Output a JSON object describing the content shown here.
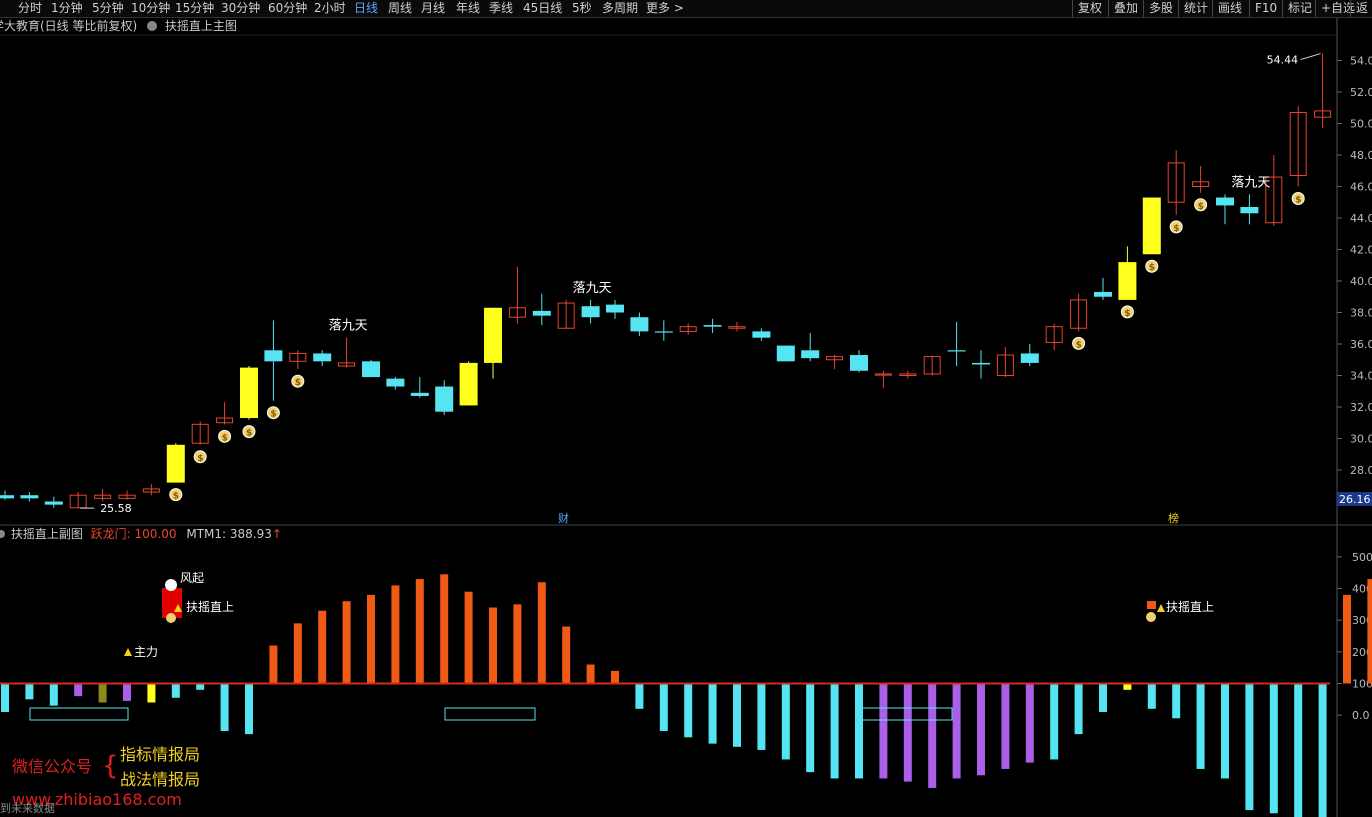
{
  "toolbar": {
    "periods": [
      "分时",
      "1分钟",
      "5分钟",
      "10分钟",
      "15分钟",
      "30分钟",
      "60分钟",
      "2小时",
      "日线",
      "周线",
      "月线",
      "年线",
      "季线",
      "45日线",
      "5秒",
      "多周期",
      "更多 >"
    ],
    "active_period": "日线",
    "right_buttons": [
      "复权",
      "叠加",
      "多股",
      "统计",
      "画线",
      "F10",
      "标记",
      "+自选",
      "返"
    ]
  },
  "main_panel": {
    "title": "学大教育(日线 等比前复权)",
    "indicator": "扶摇直上主图",
    "price_axis_ticks": [
      "54.0",
      "52.0",
      "50.0",
      "48.0",
      "46.0",
      "44.0",
      "42.0",
      "40.0",
      "38.0",
      "36.0",
      "34.0",
      "32.0",
      "30.0",
      "28.0"
    ],
    "current_price": "26.16",
    "high_label": "54.44",
    "low_label": "25.58",
    "pattern_labels": [
      "落九天",
      "落九天",
      "落九天"
    ],
    "event_marks": [
      "财",
      "榜"
    ]
  },
  "sub_panel": {
    "title": "扶摇直上副图",
    "line1_label": "跃龙门: 100.00",
    "line2_label": "MTM1: 388.93",
    "trend_arrow": "↑",
    "axis_ticks": [
      "500",
      "400",
      "300",
      "200",
      "100",
      "0.0"
    ],
    "signals": {
      "wind": "风起",
      "rise": "扶摇直上",
      "rise2": "扶摇直上",
      "main": "主力"
    }
  },
  "watermark": {
    "label": "微信公众号",
    "brace": "{",
    "line1": "指标情报局",
    "line2": "战法情报局",
    "url": "www.zhibiao168.com",
    "bottom_text": "到未来数据"
  },
  "colors": {
    "up": "#e8452e",
    "down": "#54e4f2",
    "highlight": "#ffff1e",
    "bg": "#000000",
    "grid": "#8b1a1a",
    "green_bar": "#22d822",
    "purple_bar": "#a95fe8",
    "orange_bar": "#f05a14",
    "red_bar": "#e00000",
    "olive_bar": "#8a8a18",
    "zero_line": "#d82a1a"
  },
  "chart_data": [
    {
      "type": "candlestick",
      "title": "扶摇直上主图",
      "ylim": [
        25,
        56
      ],
      "candles": [
        {
          "o": 26.4,
          "h": 26.7,
          "l": 26.1,
          "c": 26.2,
          "k": "down"
        },
        {
          "o": 26.4,
          "h": 26.6,
          "l": 26.0,
          "c": 26.2,
          "k": "down"
        },
        {
          "o": 26.0,
          "h": 26.3,
          "l": 25.6,
          "c": 25.8,
          "k": "down"
        },
        {
          "o": 25.6,
          "h": 26.6,
          "l": 25.58,
          "c": 26.4,
          "k": "up"
        },
        {
          "o": 26.2,
          "h": 26.8,
          "l": 26.0,
          "c": 26.4,
          "k": "up"
        },
        {
          "o": 26.2,
          "h": 26.7,
          "l": 26.1,
          "c": 26.4,
          "k": "up"
        },
        {
          "o": 26.6,
          "h": 27.1,
          "l": 26.4,
          "c": 26.8,
          "k": "up"
        },
        {
          "o": 27.2,
          "h": 29.7,
          "l": 27.2,
          "c": 29.6,
          "k": "hl"
        },
        {
          "o": 29.7,
          "h": 31.1,
          "l": 29.6,
          "c": 30.9,
          "k": "up"
        },
        {
          "o": 31.0,
          "h": 32.3,
          "l": 30.9,
          "c": 31.3,
          "k": "up"
        },
        {
          "o": 31.3,
          "h": 34.6,
          "l": 31.2,
          "c": 34.5,
          "k": "hl"
        },
        {
          "o": 35.6,
          "h": 37.5,
          "l": 32.4,
          "c": 34.9,
          "k": "down"
        },
        {
          "o": 34.9,
          "h": 35.6,
          "l": 34.4,
          "c": 35.4,
          "k": "up"
        },
        {
          "o": 35.4,
          "h": 35.6,
          "l": 34.6,
          "c": 34.9,
          "k": "down"
        },
        {
          "o": 34.6,
          "h": 36.4,
          "l": 34.5,
          "c": 34.8,
          "k": "up"
        },
        {
          "o": 34.9,
          "h": 35.0,
          "l": 33.9,
          "c": 33.9,
          "k": "down"
        },
        {
          "o": 33.8,
          "h": 33.9,
          "l": 33.1,
          "c": 33.3,
          "k": "down"
        },
        {
          "o": 32.9,
          "h": 33.9,
          "l": 32.6,
          "c": 32.7,
          "k": "down"
        },
        {
          "o": 33.3,
          "h": 33.7,
          "l": 31.5,
          "c": 31.7,
          "k": "down"
        },
        {
          "o": 32.1,
          "h": 34.9,
          "l": 32.1,
          "c": 34.8,
          "k": "hl"
        },
        {
          "o": 34.8,
          "h": 38.3,
          "l": 33.8,
          "c": 38.3,
          "k": "hl"
        },
        {
          "o": 37.7,
          "h": 40.9,
          "l": 37.3,
          "c": 38.3,
          "k": "up"
        },
        {
          "o": 38.1,
          "h": 39.2,
          "l": 37.2,
          "c": 37.8,
          "k": "down"
        },
        {
          "o": 37.0,
          "h": 38.8,
          "l": 37.0,
          "c": 38.6,
          "k": "up"
        },
        {
          "o": 38.4,
          "h": 38.8,
          "l": 37.3,
          "c": 37.7,
          "k": "down"
        },
        {
          "o": 38.5,
          "h": 38.8,
          "l": 37.6,
          "c": 38.0,
          "k": "down"
        },
        {
          "o": 37.7,
          "h": 38.0,
          "l": 36.5,
          "c": 36.8,
          "k": "down"
        },
        {
          "o": 36.8,
          "h": 37.5,
          "l": 36.2,
          "c": 36.8,
          "k": "down"
        },
        {
          "o": 36.8,
          "h": 37.3,
          "l": 36.6,
          "c": 37.1,
          "k": "up"
        },
        {
          "o": 37.1,
          "h": 37.6,
          "l": 36.7,
          "c": 37.2,
          "k": "down"
        },
        {
          "o": 37.1,
          "h": 37.4,
          "l": 36.8,
          "c": 37.0,
          "k": "up"
        },
        {
          "o": 36.8,
          "h": 37.0,
          "l": 36.2,
          "c": 36.4,
          "k": "down"
        },
        {
          "o": 35.9,
          "h": 35.9,
          "l": 34.9,
          "c": 34.9,
          "k": "down"
        },
        {
          "o": 35.6,
          "h": 36.7,
          "l": 34.9,
          "c": 35.1,
          "k": "down"
        },
        {
          "o": 35.0,
          "h": 35.3,
          "l": 34.4,
          "c": 35.2,
          "k": "up"
        },
        {
          "o": 35.3,
          "h": 35.6,
          "l": 34.2,
          "c": 34.3,
          "k": "down"
        },
        {
          "o": 34.1,
          "h": 34.3,
          "l": 33.2,
          "c": 34.1,
          "k": "up"
        },
        {
          "o": 34.0,
          "h": 34.3,
          "l": 33.8,
          "c": 34.1,
          "k": "up"
        },
        {
          "o": 34.1,
          "h": 35.2,
          "l": 34.0,
          "c": 35.2,
          "k": "up"
        },
        {
          "o": 35.6,
          "h": 37.4,
          "l": 34.6,
          "c": 35.6,
          "k": "down"
        },
        {
          "o": 34.7,
          "h": 35.6,
          "l": 33.8,
          "c": 34.8,
          "k": "down"
        },
        {
          "o": 34.0,
          "h": 35.8,
          "l": 33.9,
          "c": 35.3,
          "k": "up"
        },
        {
          "o": 35.4,
          "h": 36.0,
          "l": 34.6,
          "c": 34.8,
          "k": "down"
        },
        {
          "o": 36.1,
          "h": 37.3,
          "l": 35.6,
          "c": 37.1,
          "k": "up"
        },
        {
          "o": 37.0,
          "h": 39.2,
          "l": 36.8,
          "c": 38.8,
          "k": "up"
        },
        {
          "o": 39.3,
          "h": 40.2,
          "l": 38.8,
          "c": 39.0,
          "k": "down"
        },
        {
          "o": 38.8,
          "h": 42.2,
          "l": 38.8,
          "c": 41.2,
          "k": "hl"
        },
        {
          "o": 41.7,
          "h": 45.3,
          "l": 41.7,
          "c": 45.3,
          "k": "hl"
        },
        {
          "o": 45.0,
          "h": 48.3,
          "l": 44.2,
          "c": 47.5,
          "k": "up"
        },
        {
          "o": 46.0,
          "h": 47.3,
          "l": 45.6,
          "c": 46.3,
          "k": "up"
        },
        {
          "o": 45.3,
          "h": 45.5,
          "l": 43.6,
          "c": 44.8,
          "k": "down"
        },
        {
          "o": 44.7,
          "h": 45.5,
          "l": 43.6,
          "c": 44.3,
          "k": "down"
        },
        {
          "o": 43.7,
          "h": 48.0,
          "l": 43.5,
          "c": 46.6,
          "k": "up"
        },
        {
          "o": 46.7,
          "h": 51.1,
          "l": 46.0,
          "c": 50.7,
          "k": "up"
        },
        {
          "o": 50.4,
          "h": 54.44,
          "l": 49.7,
          "c": 50.8,
          "k": "up"
        }
      ]
    },
    {
      "type": "bar",
      "title": "扶摇直上副图",
      "ylim": [
        -320,
        560
      ],
      "series": [
        {
          "values": [
            -90,
            -50,
            -70,
            -40,
            -60,
            -55,
            -60,
            -45,
            -20,
            -150,
            -160,
            120,
            190,
            230,
            260,
            280,
            310,
            330,
            345,
            290,
            240,
            250,
            320,
            180,
            60,
            40,
            -80,
            -150,
            -170,
            -190,
            -200,
            -210,
            -240,
            -280,
            -300,
            -300,
            -300,
            -310,
            -330,
            -300,
            -290,
            -270,
            -250,
            -240,
            -160,
            -90,
            -20,
            -80,
            -110,
            -270,
            -300,
            -400,
            -410,
            -450,
            -460,
            280,
            330
          ]
        }
      ]
    }
  ]
}
